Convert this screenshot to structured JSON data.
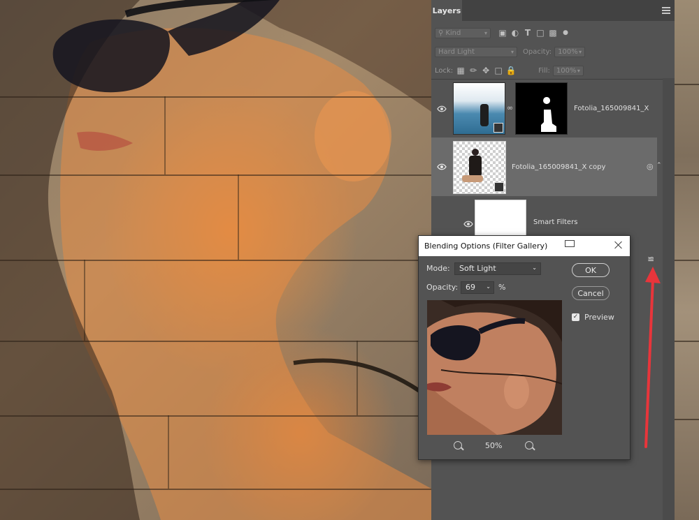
{
  "panel": {
    "tab_label": "Layers",
    "filter": {
      "kind_label": "Kind"
    },
    "blend_mode": "Hard Light",
    "opacity_label": "Opacity:",
    "opacity_value": "100%",
    "lock_label": "Lock:",
    "fill_label": "Fill:",
    "fill_value": "100%"
  },
  "layers": [
    {
      "name": "Fotolia_165009841_X"
    },
    {
      "name": "Fotolia_165009841_X copy"
    },
    {
      "name": "Smart Filters"
    }
  ],
  "dialog": {
    "title": "Blending Options (Filter Gallery)",
    "mode_label": "Mode:",
    "mode_value": "Soft Light",
    "opacity_label": "Opacity:",
    "opacity_value": "69",
    "opacity_unit": "%",
    "ok_label": "OK",
    "cancel_label": "Cancel",
    "preview_label": "Preview",
    "preview_checked": true,
    "zoom_value": "50%"
  },
  "colors": {
    "arrow": "#e8353b",
    "panel_bg": "#535353",
    "dialog_titlebar": "#ffffff"
  }
}
